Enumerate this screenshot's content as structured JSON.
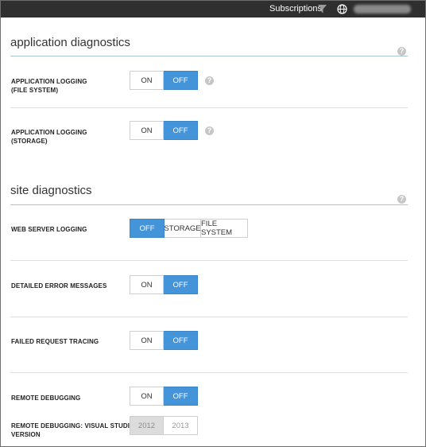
{
  "topbar": {
    "subscriptions_label": "Subscriptions",
    "filter_icon": "filter-icon",
    "globe_icon": "globe-icon"
  },
  "sections": {
    "app_diag": {
      "title": "application diagnostics",
      "help": "?"
    },
    "site_diag": {
      "title": "site diagnostics",
      "help": "?"
    }
  },
  "settings": {
    "app_logging_fs": {
      "label_line1": "APPLICATION LOGGING",
      "label_line2": "(FILE SYSTEM)",
      "on": "ON",
      "off": "OFF",
      "value": "OFF",
      "help": "?"
    },
    "app_logging_storage": {
      "label_line1": "APPLICATION LOGGING",
      "label_line2": "(STORAGE)",
      "on": "ON",
      "off": "OFF",
      "value": "OFF",
      "help": "?"
    },
    "web_server_logging": {
      "label": "WEB SERVER LOGGING",
      "options": [
        "OFF",
        "STORAGE",
        "FILE SYSTEM"
      ],
      "value": "OFF"
    },
    "detailed_errors": {
      "label": "DETAILED ERROR MESSAGES",
      "on": "ON",
      "off": "OFF",
      "value": "OFF"
    },
    "failed_request": {
      "label": "FAILED REQUEST TRACING",
      "on": "ON",
      "off": "OFF",
      "value": "OFF"
    },
    "remote_debugging": {
      "label": "REMOTE DEBUGGING",
      "on": "ON",
      "off": "OFF",
      "value": "OFF"
    },
    "remote_debugging_vs": {
      "label_line1": "REMOTE DEBUGGING: VISUAL STUDIO",
      "label_line2": "VERSION",
      "options": [
        "2012",
        "2013"
      ],
      "value": "2012",
      "disabled": true
    }
  },
  "colors": {
    "accent": "#4394d8",
    "topbar": "#2f2f2f",
    "section_rule": "#a7c7d3"
  }
}
